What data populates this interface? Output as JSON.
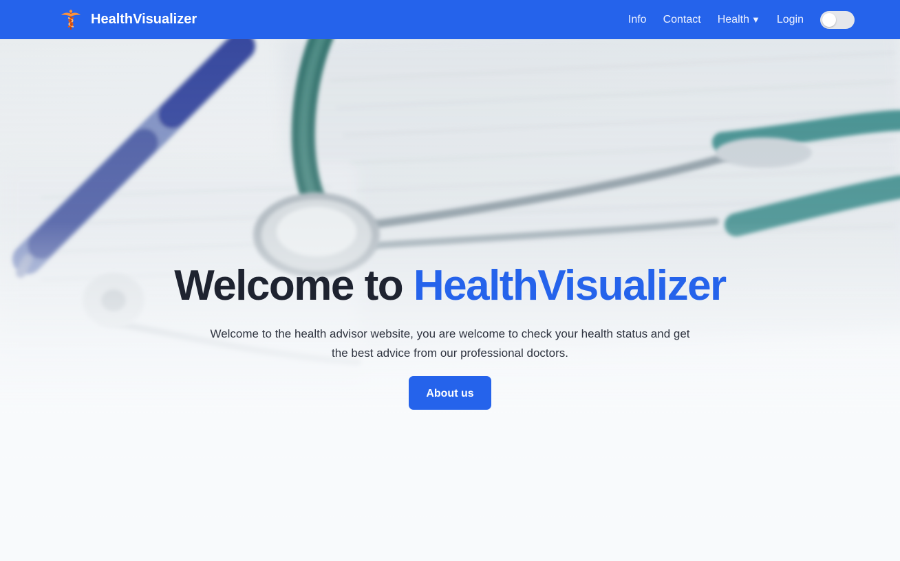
{
  "navbar": {
    "brand_name": "HealthVisualizer",
    "logo_icon": "caduceus-icon",
    "links": [
      {
        "label": "Info"
      },
      {
        "label": "Contact"
      },
      {
        "label": "Health",
        "caret": "▼"
      },
      {
        "label": "Login"
      }
    ],
    "theme_toggle": {
      "icon": "theme-toggle",
      "state": "off"
    }
  },
  "hero": {
    "background_image": "stethoscope-pen-medical-chart",
    "title_prefix": "Welcome to",
    "title_accent": "HealthVisualizer",
    "subtitle": "Welcome to the health advisor website, you are welcome to check your health status and get the best advice from our professional doctors.",
    "button_label": "About us"
  },
  "colors": {
    "primary": "#2563eb",
    "heading_dark": "#1e2330",
    "page_background": "#f8fafc",
    "toggle_track": "#e5e7eb"
  }
}
